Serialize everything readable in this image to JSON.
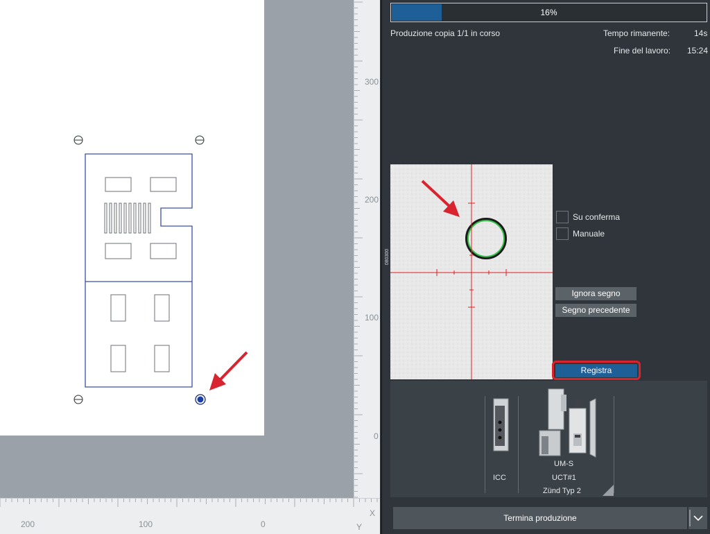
{
  "progress": {
    "percent": 16,
    "label": "16%"
  },
  "status": {
    "production_text": "Produzione copia 1/1 in corso",
    "remaining_label": "Tempo rimanente:",
    "remaining_value": "14s",
    "end_label": "Fine del lavoro:",
    "end_value": "15:24"
  },
  "camera": {
    "side_label": "080300",
    "options": [
      {
        "label": "Su conferma"
      },
      {
        "label": "Manuale"
      }
    ]
  },
  "buttons": {
    "ignore_mark": "Ignora segno",
    "previous_mark": "Segno precedente",
    "record": "Registra",
    "end_production": "Termina produzione"
  },
  "tools": {
    "icc_label": "ICC",
    "umS_label": "UM-S",
    "uct_label": "UCT#1",
    "zund_label": "Zünd Typ 2"
  },
  "rulers": {
    "vertical_ticks": [
      "300",
      "200",
      "100",
      "0"
    ],
    "horizontal_ticks": [
      "200",
      "100",
      "0"
    ],
    "x_axis": "X",
    "y_axis": "Y"
  },
  "colors": {
    "accent_blue": "#1f5f98",
    "highlight_red": "#d9232e",
    "cut_line": "#3a4fa0",
    "detected_mark": "#33c24a"
  },
  "icons": {
    "registration_mark": "crosshair-circle-icon",
    "selected_mark": "selected-registration-mark-icon",
    "dropdown": "chevron-down-icon",
    "corner": "resize-corner-icon"
  }
}
